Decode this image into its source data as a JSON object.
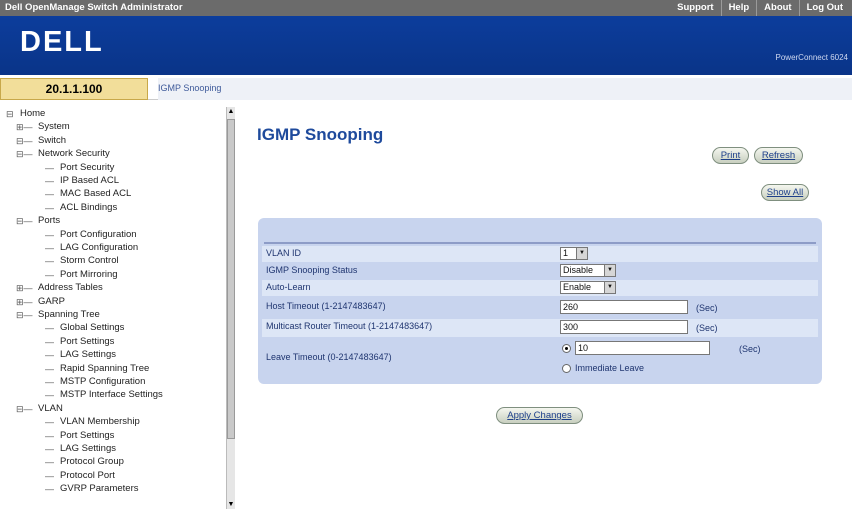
{
  "header": {
    "app_title": "Dell OpenManage Switch Administrator",
    "links": [
      "Support",
      "Help",
      "About",
      "Log Out"
    ],
    "logo": "DELL",
    "product": "PowerConnect 6024"
  },
  "device": {
    "ip": "20.1.1.100",
    "breadcrumb": "IGMP Snooping"
  },
  "tree": {
    "items": [
      {
        "label": "Home",
        "depth": 0
      },
      {
        "label": "System",
        "depth": 1
      },
      {
        "label": "Switch",
        "depth": 1
      },
      {
        "label": "Network Security",
        "depth": 2
      },
      {
        "label": "Port Security",
        "depth": 3
      },
      {
        "label": "IP Based ACL",
        "depth": 3
      },
      {
        "label": "MAC Based ACL",
        "depth": 3
      },
      {
        "label": "ACL Bindings",
        "depth": 3
      },
      {
        "label": "Ports",
        "depth": 2
      },
      {
        "label": "Port Configuration",
        "depth": 3
      },
      {
        "label": "LAG Configuration",
        "depth": 3
      },
      {
        "label": "Storm Control",
        "depth": 3
      },
      {
        "label": "Port Mirroring",
        "depth": 3
      },
      {
        "label": "Address Tables",
        "depth": 2
      },
      {
        "label": "GARP",
        "depth": 2
      },
      {
        "label": "Spanning Tree",
        "depth": 2
      },
      {
        "label": "Global Settings",
        "depth": 3
      },
      {
        "label": "Port Settings",
        "depth": 3
      },
      {
        "label": "LAG Settings",
        "depth": 3
      },
      {
        "label": "Rapid Spanning Tree",
        "depth": 3
      },
      {
        "label": "MSTP Configuration",
        "depth": 3
      },
      {
        "label": "MSTP Interface Settings",
        "depth": 3
      },
      {
        "label": "VLAN",
        "depth": 2
      },
      {
        "label": "VLAN Membership",
        "depth": 3
      },
      {
        "label": "Port Settings",
        "depth": 3
      },
      {
        "label": "LAG Settings",
        "depth": 3
      },
      {
        "label": "Protocol Group",
        "depth": 3
      },
      {
        "label": "Protocol Port",
        "depth": 3
      },
      {
        "label": "GVRP Parameters",
        "depth": 3
      }
    ]
  },
  "main": {
    "title": "IGMP Snooping",
    "print_label": "Print",
    "refresh_label": "Refresh",
    "show_all_label": "Show All",
    "apply_label": "Apply Changes"
  },
  "form": {
    "vlan_id_label": "VLAN ID",
    "vlan_id_value": "1",
    "snooping_status_label": "IGMP Snooping Status",
    "snooping_status_value": "Disable",
    "auto_learn_label": "Auto-Learn",
    "auto_learn_value": "Enable",
    "host_timeout_label": "Host Timeout (1-2147483647)",
    "host_timeout_value": "260",
    "router_timeout_label": "Multicast Router Timeout (1-2147483647)",
    "router_timeout_value": "300",
    "leave_timeout_label": "Leave Timeout (0-2147483647)",
    "leave_timeout_value": "10",
    "immediate_leave_label": "Immediate Leave",
    "leave_timeout_selected": "custom",
    "unit": "(Sec)"
  },
  "colors": {
    "title_bar": "#6b6b6b",
    "dell_blue": "#0c3d9c",
    "ip_box": "#f2de9a",
    "page_title": "#1e4a9c",
    "panel": "#c8d4ee",
    "row_light": "#dde6f6"
  }
}
